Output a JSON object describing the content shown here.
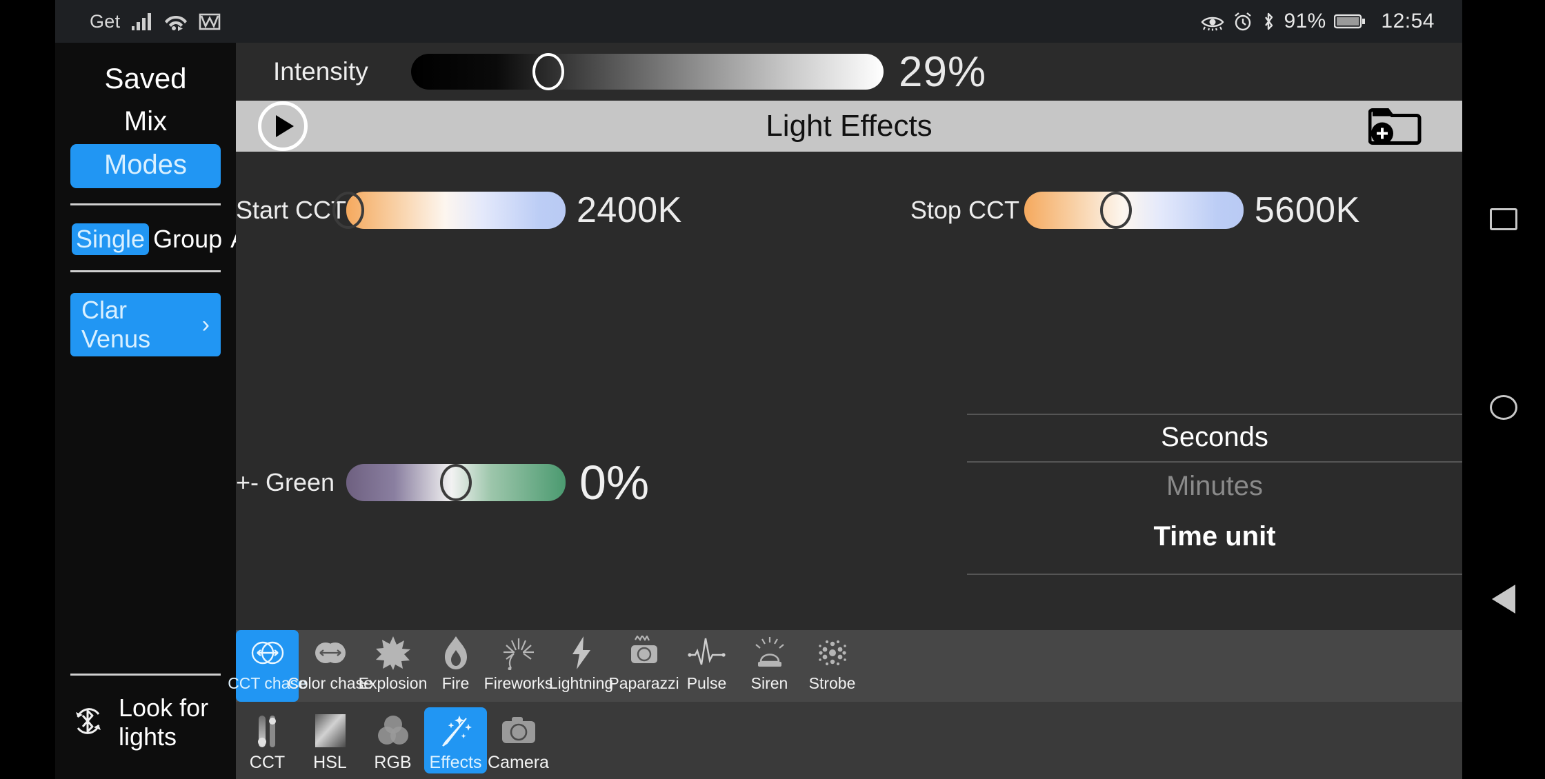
{
  "statusbar": {
    "carrier": "Get",
    "icons_left": [
      "signal-bars-icon",
      "wifi-icon",
      "gmail-icon"
    ],
    "icons_right": [
      "eye-comfort-icon",
      "alarm-icon",
      "bluetooth-icon"
    ],
    "battery_percent": "91%",
    "battery_icon": "battery-icon",
    "time": "12:54"
  },
  "sidebar": {
    "saved_label": "Saved",
    "mix_label": "Mix",
    "modes_label": "Modes",
    "scope": [
      {
        "label": "Single",
        "selected": true
      },
      {
        "label": "Group",
        "selected": false
      },
      {
        "label": "All",
        "selected": false
      }
    ],
    "device": {
      "name": "Clar Venus",
      "chevron": "›"
    },
    "look_for_lights": "Look for lights",
    "accent": "#2196f3"
  },
  "intensity": {
    "label": "Intensity",
    "value": "29%",
    "percent": 29
  },
  "effects_header": {
    "title": "Light Effects",
    "play_icon": "play-icon",
    "save_icon": "folder-add-icon"
  },
  "controls": {
    "start_cct": {
      "label": "Start CCT",
      "value": "2400K",
      "percent": 1
    },
    "stop_cct": {
      "label": "Stop CCT",
      "value": "5600K",
      "percent": 42
    },
    "green": {
      "label": "+- Green",
      "value": "0%",
      "percent": 50
    }
  },
  "time_unit": {
    "selected": "Seconds",
    "next": "Minutes",
    "label": "Time unit"
  },
  "effects": [
    {
      "label": "CCT chase",
      "icon": "cct-chase-icon",
      "selected": true
    },
    {
      "label": "Color chase",
      "icon": "color-chase-icon",
      "selected": false
    },
    {
      "label": "Explosion",
      "icon": "explosion-icon",
      "selected": false
    },
    {
      "label": "Fire",
      "icon": "fire-icon",
      "selected": false
    },
    {
      "label": "Fireworks",
      "icon": "fireworks-icon",
      "selected": false
    },
    {
      "label": "Lightning",
      "icon": "lightning-icon",
      "selected": false
    },
    {
      "label": "Paparazzi",
      "icon": "paparazzi-icon",
      "selected": false
    },
    {
      "label": "Pulse",
      "icon": "pulse-icon",
      "selected": false
    },
    {
      "label": "Siren",
      "icon": "siren-icon",
      "selected": false
    },
    {
      "label": "Strobe",
      "icon": "strobe-icon",
      "selected": false
    }
  ],
  "bottom_nav": [
    {
      "label": "CCT",
      "icon": "cct-sliders-icon",
      "selected": false
    },
    {
      "label": "HSL",
      "icon": "hsl-gradient-icon",
      "selected": false
    },
    {
      "label": "RGB",
      "icon": "rgb-circles-icon",
      "selected": false
    },
    {
      "label": "Effects",
      "icon": "magic-wand-icon",
      "selected": true
    },
    {
      "label": "Camera",
      "icon": "camera-icon",
      "selected": false
    }
  ],
  "android_nav": {
    "recents": "recents-square-icon",
    "home": "home-circle-icon",
    "back": "back-triangle-icon"
  }
}
